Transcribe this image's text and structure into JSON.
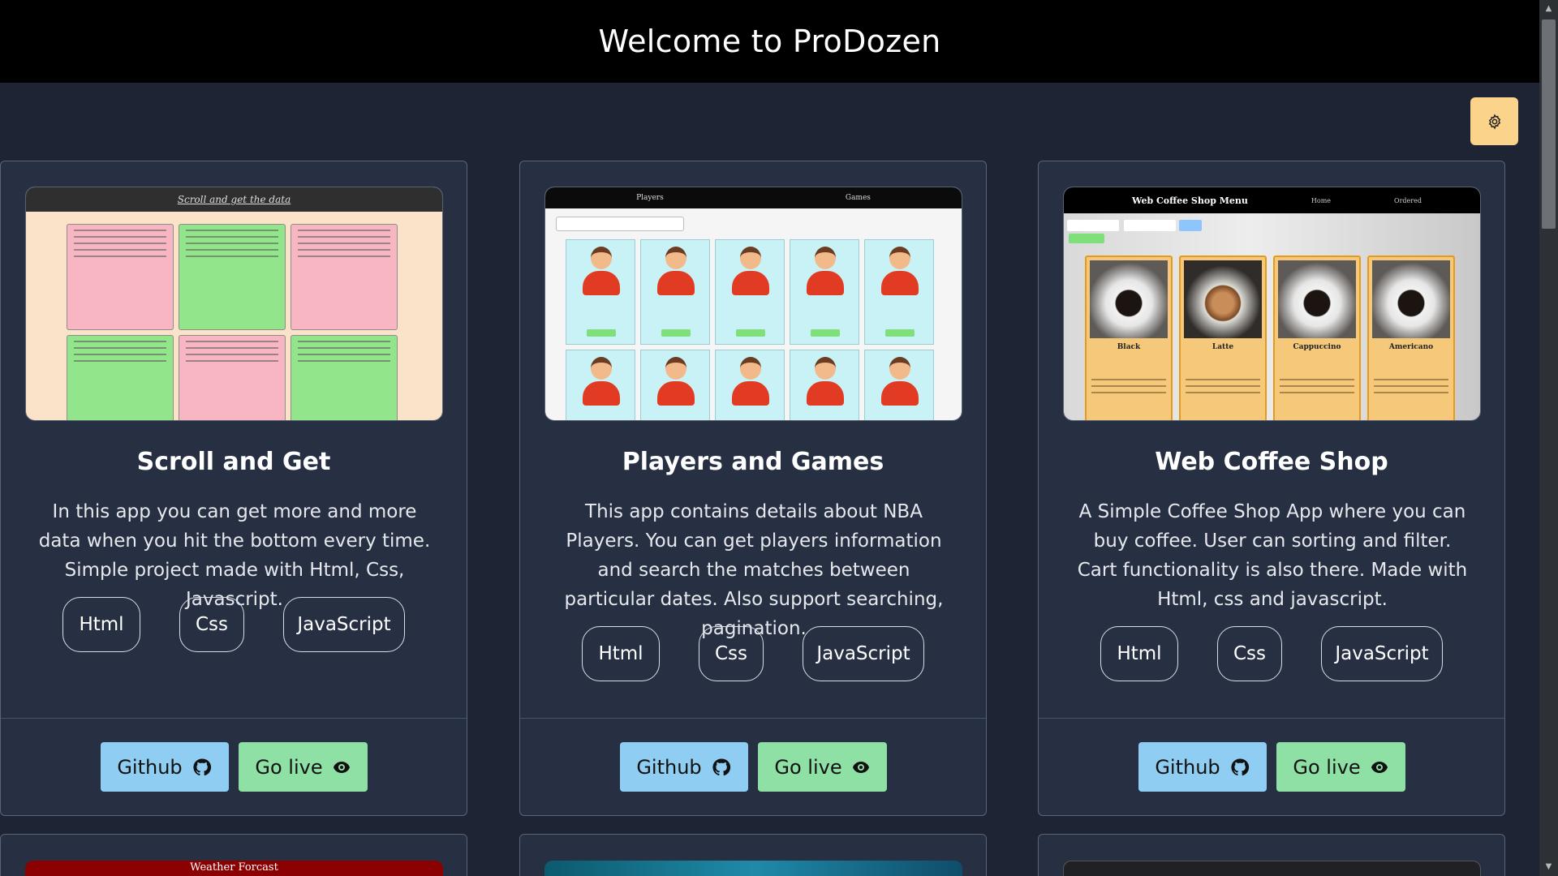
{
  "header": {
    "title": "Welcome to ProDozen"
  },
  "settings": {
    "icon": "gear-icon"
  },
  "colors": {
    "header_bg": "#000000",
    "page_bg": "#1e2433",
    "card_bg": "#273043",
    "settings_bg": "#fcd38a",
    "github_bg": "#8fcdf2",
    "live_bg": "#8fe0a5"
  },
  "cards": [
    {
      "title": "Scroll and Get",
      "description": "In this app you can get more and more data when you hit the bottom every time. Simple project made with Html, Css, Javascript.",
      "tags": [
        "Html",
        "Css",
        "JavaScript"
      ],
      "github_label": "Github",
      "live_label": "Go live",
      "thumb_header": "Scroll and get the data"
    },
    {
      "title": "Players and Games",
      "description": "This app contains details about NBA Players. You can get players information and search the matches between particular dates. Also support searching, pagination.",
      "tags": [
        "Html",
        "Css",
        "JavaScript"
      ],
      "github_label": "Github",
      "live_label": "Go live",
      "thumb_tabs": [
        "Players",
        "Games"
      ]
    },
    {
      "title": "Web Coffee Shop",
      "description": "A Simple Coffee Shop App where you can buy coffee. User can sorting and filter. Cart functionality is also there. Made with Html, css and javascript.",
      "tags": [
        "Html",
        "Css",
        "JavaScript"
      ],
      "github_label": "Github",
      "live_label": "Go live",
      "thumb_header": "Web Coffee Shop Menu",
      "thumb_nav": [
        "Home",
        "Ordered"
      ],
      "thumb_items": [
        "Black",
        "Latte",
        "Cappuccino",
        "Americano"
      ]
    }
  ],
  "next_row": [
    {
      "thumb_header": "Weather Forcast"
    }
  ]
}
